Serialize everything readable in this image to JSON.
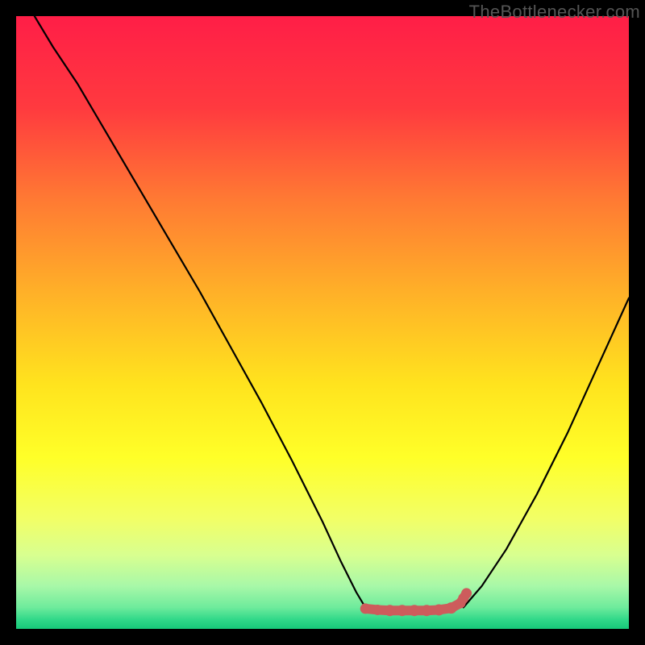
{
  "watermark": "TheBottlenecker.com",
  "colors": {
    "black": "#000000",
    "line": "#000000",
    "dot": "#CD5C5C",
    "watermark_text": "#555555"
  },
  "chart_data": {
    "type": "line",
    "title": "",
    "xlabel": "",
    "ylabel": "",
    "xlim": [
      0,
      100
    ],
    "ylim": [
      0,
      100
    ],
    "gradient_stops": [
      {
        "offset": 0.0,
        "color": "#FF1E47"
      },
      {
        "offset": 0.15,
        "color": "#FF3A3F"
      },
      {
        "offset": 0.3,
        "color": "#FF7A33"
      },
      {
        "offset": 0.45,
        "color": "#FFB028"
      },
      {
        "offset": 0.6,
        "color": "#FFE31E"
      },
      {
        "offset": 0.72,
        "color": "#FFFF28"
      },
      {
        "offset": 0.82,
        "color": "#F2FF66"
      },
      {
        "offset": 0.88,
        "color": "#D8FF90"
      },
      {
        "offset": 0.93,
        "color": "#A8F8A8"
      },
      {
        "offset": 0.965,
        "color": "#6EEB9C"
      },
      {
        "offset": 0.985,
        "color": "#30D889"
      },
      {
        "offset": 1.0,
        "color": "#17C97A"
      }
    ],
    "series": [
      {
        "name": "left-curve",
        "x": [
          3,
          6,
          10,
          15,
          20,
          25,
          30,
          35,
          40,
          45,
          50,
          53,
          55.5,
          57
        ],
        "y": [
          100,
          95,
          89,
          80.5,
          72,
          63.5,
          55,
          46,
          37,
          27.5,
          17.5,
          11,
          6,
          3.5
        ]
      },
      {
        "name": "right-curve",
        "x": [
          73,
          76,
          80,
          85,
          90,
          95,
          100
        ],
        "y": [
          3.5,
          7,
          13,
          22,
          32,
          43,
          54
        ]
      }
    ],
    "flat_band": {
      "name": "valley-dots",
      "x": [
        57,
        59,
        61,
        63,
        65,
        67,
        69,
        71,
        72.5,
        73,
        73.5
      ],
      "y": [
        3.3,
        3.1,
        3.0,
        3.0,
        3.0,
        3.0,
        3.1,
        3.4,
        4.2,
        5.0,
        5.8
      ]
    }
  }
}
